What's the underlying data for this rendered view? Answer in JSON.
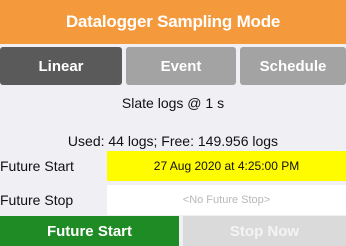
{
  "header": {
    "title": "Datalogger Sampling Mode"
  },
  "tabs": [
    {
      "label": "Linear",
      "state": "selected"
    },
    {
      "label": "Event",
      "state": "unselected"
    },
    {
      "label": "Schedule",
      "state": "unselected"
    }
  ],
  "status": {
    "rate": "Slate logs @ 1 s",
    "usage": "Used: 44 logs; Free: 149.956 logs"
  },
  "future_start": {
    "label": "Future Start",
    "value": "27 Aug 2020 at 4:25:00 PM"
  },
  "future_stop": {
    "label": "Future Stop",
    "placeholder": "<No Future Stop>"
  },
  "buttons": {
    "start_label": "Future Start",
    "stop_label": "Stop Now",
    "stop_disabled": true
  },
  "colors": {
    "header": "#f49a3c",
    "tab_selected": "#5a5a5a",
    "tab_unselected": "#a3a3a3",
    "start_field": "#fffc00",
    "start_button": "#1f8b24",
    "stop_button_disabled": "#dadada"
  }
}
